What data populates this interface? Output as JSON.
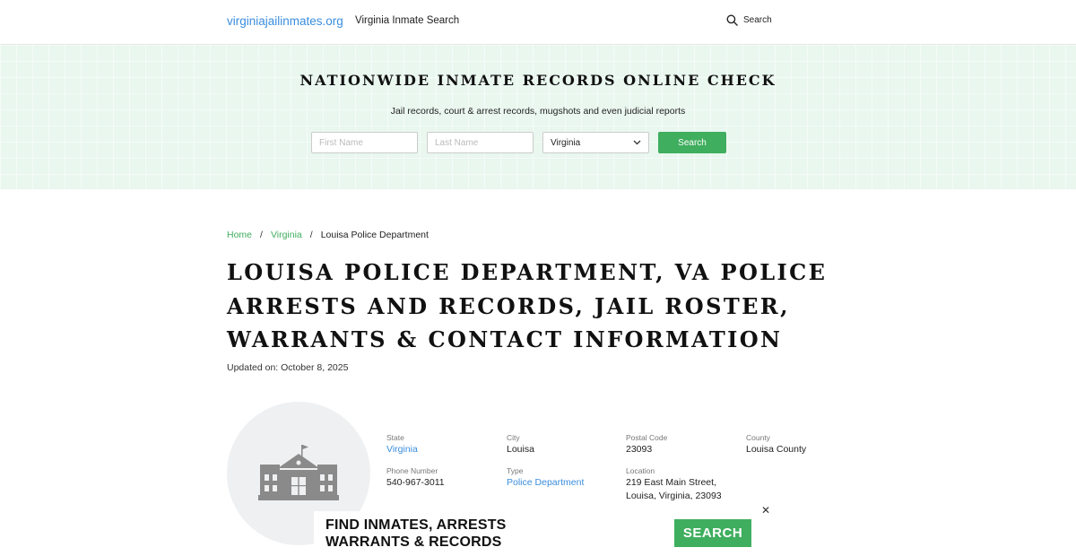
{
  "header": {
    "brand": "virginiajailinmates.org",
    "nav_link": "Virginia Inmate Search",
    "search_label": "Search"
  },
  "hero": {
    "title": "NATIONWIDE INMATE RECORDS ONLINE CHECK",
    "subtitle": "Jail records, court & arrest records, mugshots and even judicial reports",
    "first_name_placeholder": "First Name",
    "last_name_placeholder": "Last Name",
    "state_selected": "Virginia",
    "search_button": "Search"
  },
  "breadcrumb": {
    "home": "Home",
    "state": "Virginia",
    "current": "Louisa Police Department",
    "separator": "/"
  },
  "page": {
    "title": "LOUISA POLICE DEPARTMENT, VA POLICE ARRESTS AND RECORDS, JAIL ROSTER, WARRANTS & CONTACT INFORMATION",
    "updated": "Updated on: October 8, 2025"
  },
  "info": {
    "state_label": "State",
    "state_value": "Virginia",
    "city_label": "City",
    "city_value": "Louisa",
    "postal_label": "Postal Code",
    "postal_value": "23093",
    "county_label": "County",
    "county_value": "Louisa County",
    "phone_label": "Phone Number",
    "phone_value": "540-967-3011",
    "type_label": "Type",
    "type_value": "Police Department",
    "location_label": "Location",
    "location_line1": "219 East Main Street,",
    "location_line2": "Louisa, Virginia, 23093"
  },
  "ad": {
    "line1": "FIND INMATES, ARRESTS",
    "line2": "WARRANTS & RECORDS",
    "button": "SEARCH",
    "close": "✕"
  },
  "icons": {
    "search": "search-icon",
    "building": "government-building-icon",
    "close": "close-icon",
    "dropdown": "chevron-down-icon"
  },
  "colors": {
    "brand_blue": "#3a8dde",
    "accent_green": "#3fae5e",
    "hero_bg": "#e9f7ef"
  }
}
